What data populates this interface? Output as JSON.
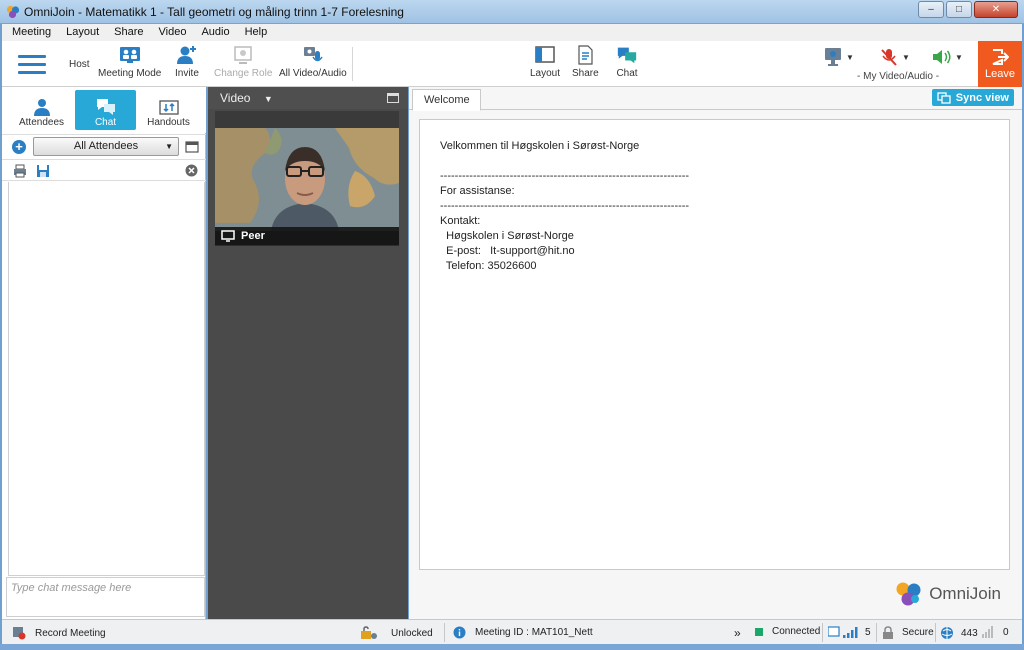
{
  "window": {
    "title": "OmniJoin - Matematikk 1 - Tall  geometri og måling  trinn 1-7  Forelesning",
    "controls": [
      "minimize",
      "maximize",
      "close"
    ]
  },
  "menu": [
    "Meeting",
    "Layout",
    "Share",
    "Video",
    "Audio",
    "Help"
  ],
  "toolbar": {
    "host_label": "Host",
    "meeting_mode": "Meeting Mode",
    "invite": "Invite",
    "change_role": "Change Role",
    "all_video_audio": "All Video/Audio",
    "layout": "Layout",
    "share": "Share",
    "chat": "Chat",
    "my_video_audio": "- My Video/Audio -",
    "leave": "Leave"
  },
  "left_panel": {
    "tabs": [
      {
        "label": "Attendees",
        "active": false
      },
      {
        "label": "Chat",
        "active": true
      },
      {
        "label": "Handouts",
        "active": false
      }
    ],
    "recipient_select": "All Attendees",
    "chat_placeholder": "Type chat message here"
  },
  "video_panel": {
    "header": "Video",
    "participant_name": "Peer"
  },
  "content_panel": {
    "tab": "Welcome",
    "sync_button": "Sync view",
    "document": {
      "welcome": "Velkommen til Høgskolen i Sørøst-Norge",
      "divider": "--------------------------------------------------------------------",
      "assistance": "For assistanse:",
      "contact_heading": "Kontakt:",
      "org": "  Høgskolen i Sørøst-Norge",
      "email": "  E-post:   It-support@hit.no",
      "phone": "  Telefon: 35026600"
    },
    "brand": "OmniJoin"
  },
  "status_bar": {
    "record": "Record Meeting",
    "lock": "Unlocked",
    "meeting_id": "Meeting ID : MAT101_Nett",
    "more": "»",
    "connection": "Connected",
    "signal": "5",
    "security": "Secure",
    "port": "443",
    "count": "0"
  },
  "colors": {
    "accent": "#27a8d6",
    "toolbar_icon_blue": "#2a7fc4",
    "leave": "#f05a1e",
    "video_panel_bg": "#4a4a4a",
    "connected_indicator": "#19a86a",
    "mute_red": "#d9362a",
    "speaker_green": "#3aa64a"
  },
  "icons": {
    "menu": "hamburger-icon",
    "meeting_mode": "meeting-mode-icon",
    "invite": "add-person-icon",
    "change_role": "change-role-icon",
    "all_video_audio": "video-mic-icon",
    "layout": "layout-icon",
    "share": "document-share-icon",
    "chat": "chat-bubbles-icon",
    "webcam": "webcam-icon",
    "mic_muted": "microphone-muted-icon",
    "speaker": "speaker-icon",
    "leave": "exit-door-icon"
  }
}
